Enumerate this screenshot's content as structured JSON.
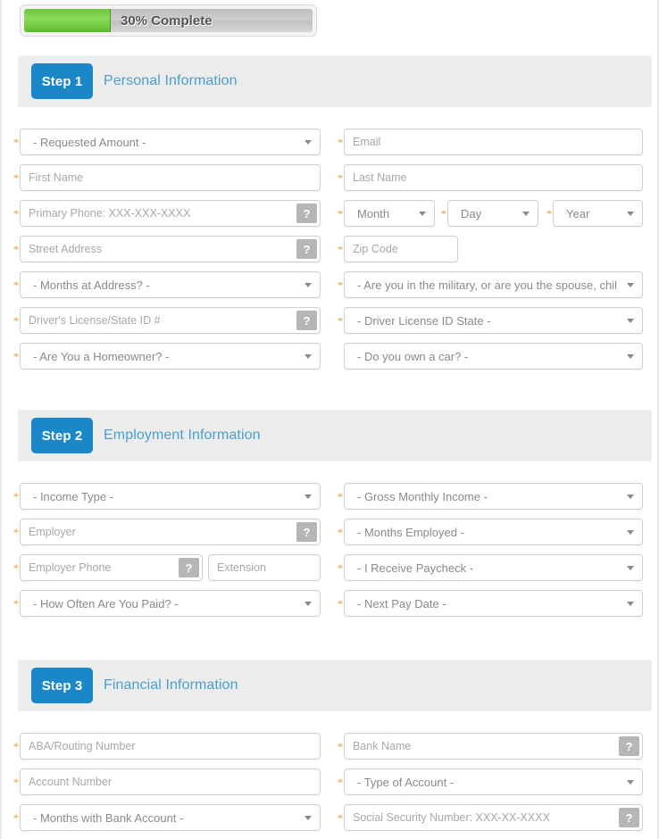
{
  "progress": {
    "percent": 30,
    "label": "30% Complete",
    "fill_color": "#7fd24c",
    "track_color": "#c9c9c9"
  },
  "theme": {
    "badge_color": "#1a87c8",
    "title_color": "#4a9fd0",
    "header_band_color": "#ececec",
    "required_marker_color": "#e8a33d",
    "help_button_color": "#b6b6b6"
  },
  "help_glyph": "?",
  "steps": [
    {
      "badge": "Step 1",
      "title": "Personal Information",
      "fields": [
        {
          "name": "requested-amount",
          "type": "select",
          "value": "- Requested Amount -",
          "required": true,
          "col": "left",
          "row": 0
        },
        {
          "name": "email",
          "type": "text",
          "value": "Email",
          "required": true,
          "col": "right",
          "row": 0
        },
        {
          "name": "first-name",
          "type": "text",
          "value": "First Name",
          "required": true,
          "col": "left",
          "row": 1
        },
        {
          "name": "last-name",
          "type": "text",
          "value": "Last Name",
          "required": true,
          "col": "right",
          "row": 1
        },
        {
          "name": "primary-phone",
          "type": "text",
          "value": "Primary Phone: XXX-XXX-XXXX",
          "required": true,
          "help": true,
          "col": "left",
          "row": 2
        },
        {
          "name": "birth-month",
          "type": "select",
          "value": "Month",
          "required": true,
          "col": "dob1",
          "row": 2
        },
        {
          "name": "birth-day",
          "type": "select",
          "value": "Day",
          "required": true,
          "col": "dob2",
          "row": 2
        },
        {
          "name": "birth-year",
          "type": "select",
          "value": "Year",
          "required": true,
          "col": "dob3",
          "row": 2
        },
        {
          "name": "street-address",
          "type": "text",
          "value": "Street Address",
          "required": true,
          "help": true,
          "col": "left",
          "row": 3
        },
        {
          "name": "zip-code",
          "type": "text",
          "value": "Zip Code",
          "required": true,
          "col": "narrow",
          "row": 3
        },
        {
          "name": "months-at-address",
          "type": "select",
          "value": "- Months at Address? -",
          "required": true,
          "col": "left",
          "row": 4
        },
        {
          "name": "military-status",
          "type": "select",
          "value": "- Are you in the military, or are you the spouse, chil",
          "required": true,
          "col": "right",
          "row": 4
        },
        {
          "name": "drivers-license",
          "type": "text",
          "value": "Driver's License/State ID #",
          "required": true,
          "help": true,
          "col": "left",
          "row": 5
        },
        {
          "name": "license-state",
          "type": "select",
          "value": "- Driver License ID State -",
          "required": true,
          "col": "right",
          "row": 5
        },
        {
          "name": "homeowner",
          "type": "select",
          "value": "- Are You a Homeowner? -",
          "required": true,
          "col": "left",
          "row": 6
        },
        {
          "name": "own-a-car",
          "type": "select",
          "value": "- Do you own a car? -",
          "required": false,
          "col": "right",
          "row": 6
        }
      ]
    },
    {
      "badge": "Step 2",
      "title": "Employment Information",
      "fields": [
        {
          "name": "income-type",
          "type": "select",
          "value": "- Income Type -",
          "required": true,
          "col": "left",
          "row": 0
        },
        {
          "name": "gross-monthly-income",
          "type": "select",
          "value": "- Gross Monthly Income -",
          "required": true,
          "col": "right",
          "row": 0
        },
        {
          "name": "employer",
          "type": "text",
          "value": "Employer",
          "required": true,
          "help": true,
          "col": "left",
          "row": 1
        },
        {
          "name": "months-employed",
          "type": "select",
          "value": "- Months Employed -",
          "required": true,
          "col": "right",
          "row": 1
        },
        {
          "name": "employer-phone",
          "type": "text",
          "value": "Employer Phone",
          "required": true,
          "help": true,
          "col": "half1",
          "row": 2
        },
        {
          "name": "extension",
          "type": "text",
          "value": "Extension",
          "required": false,
          "col": "half2",
          "row": 2
        },
        {
          "name": "paycheck-method",
          "type": "select",
          "value": "- I Receive Paycheck -",
          "required": true,
          "col": "right",
          "row": 2
        },
        {
          "name": "pay-frequency",
          "type": "select",
          "value": "- How Often Are You Paid? -",
          "required": true,
          "col": "left",
          "row": 3
        },
        {
          "name": "next-pay-date",
          "type": "select",
          "value": "- Next Pay Date -",
          "required": true,
          "col": "right",
          "row": 3
        }
      ]
    },
    {
      "badge": "Step 3",
      "title": "Financial Information",
      "fields": [
        {
          "name": "aba-routing-number",
          "type": "text",
          "value": "ABA/Routing Number",
          "required": true,
          "col": "left",
          "row": 0
        },
        {
          "name": "bank-name",
          "type": "text",
          "value": "Bank Name",
          "required": true,
          "help": true,
          "col": "right",
          "row": 0
        },
        {
          "name": "account-number",
          "type": "text",
          "value": "Account Number",
          "required": true,
          "col": "left",
          "row": 1
        },
        {
          "name": "type-of-account",
          "type": "select",
          "value": "- Type of Account -",
          "required": true,
          "col": "right",
          "row": 1
        },
        {
          "name": "months-with-bank",
          "type": "select",
          "value": "- Months with Bank Account -",
          "required": true,
          "col": "left",
          "row": 2
        },
        {
          "name": "social-security-number",
          "type": "text",
          "value": "Social Security Number: XXX-XX-XXXX",
          "required": true,
          "help": true,
          "col": "right",
          "row": 2
        }
      ]
    }
  ]
}
